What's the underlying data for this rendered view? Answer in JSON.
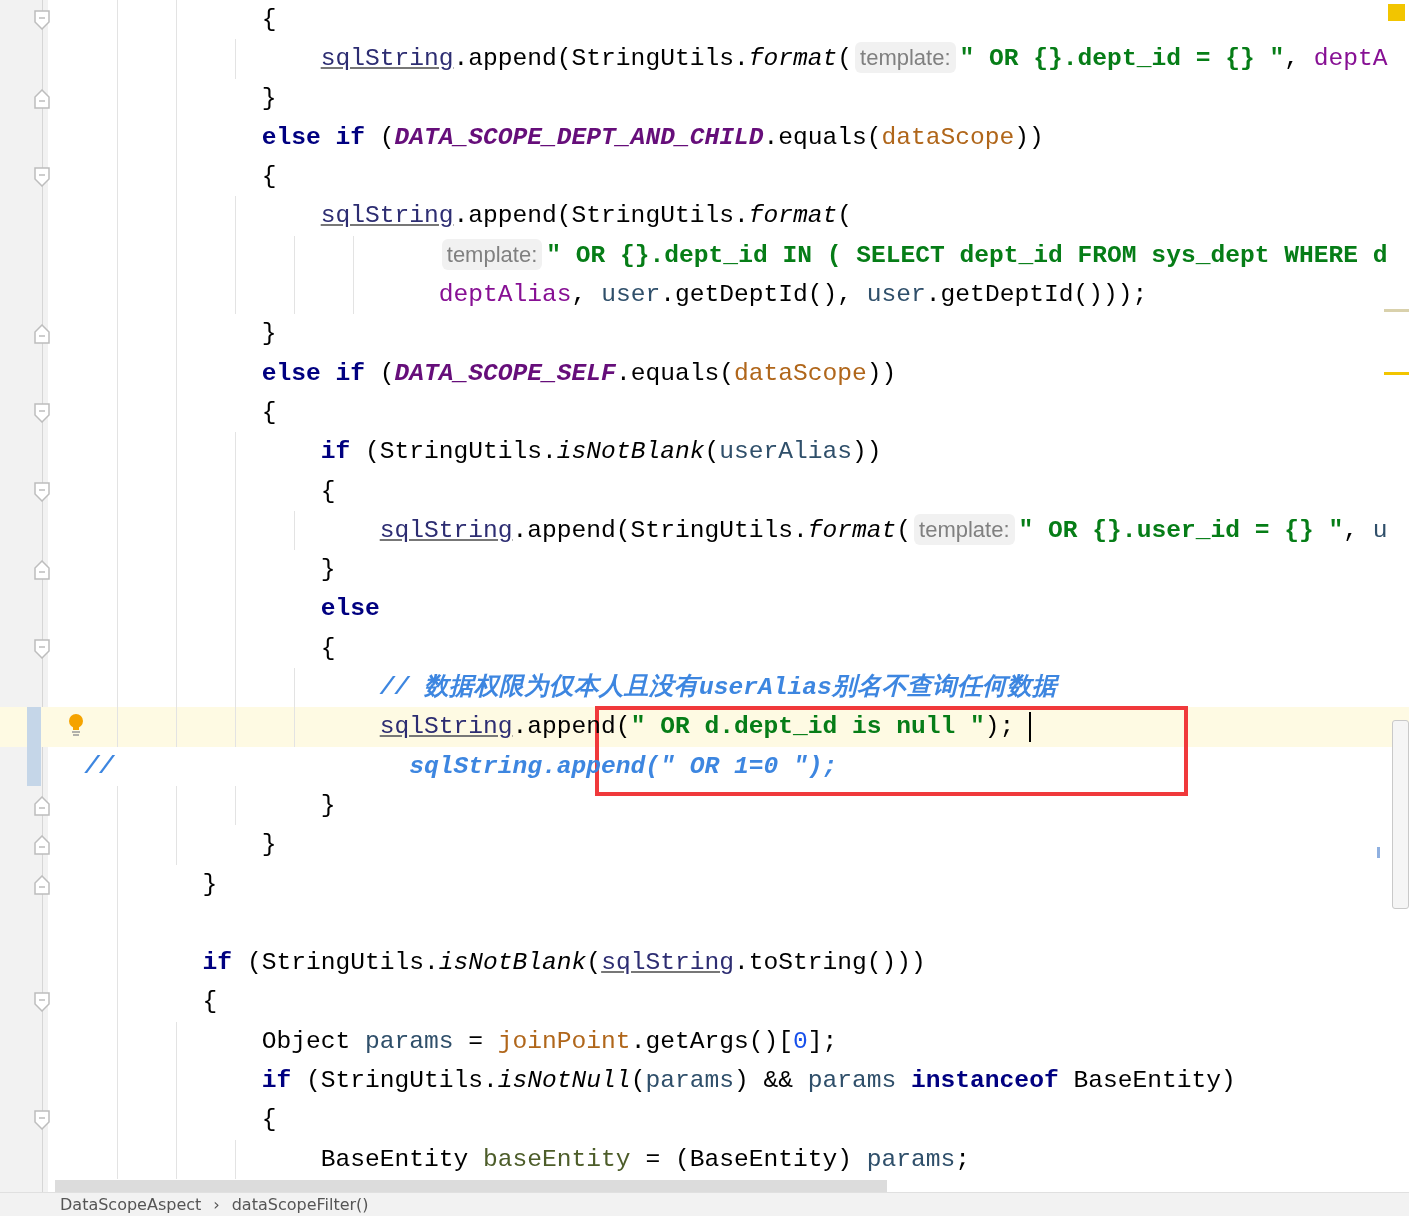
{
  "editor": {
    "lines": [
      {
        "kind": "fold-start",
        "current": false,
        "changed": false,
        "tokens": [
          {
            "kind": "plain",
            "text": "{"
          }
        ]
      },
      {
        "kind": "code",
        "current": false,
        "changed": false,
        "tokens": [
          {
            "kind": "var",
            "text": "sqlString"
          },
          {
            "kind": "plain",
            "text": ".append(StringUtils."
          },
          {
            "kind": "static",
            "text": "format"
          },
          {
            "kind": "plain",
            "text": "("
          },
          {
            "kind": "hint",
            "text": "template:"
          },
          {
            "kind": "string",
            "text": "\" OR {}.dept_id = {} \""
          },
          {
            "kind": "plain",
            "text": ", "
          },
          {
            "kind": "field",
            "text": "deptA"
          }
        ]
      },
      {
        "kind": "fold-end",
        "current": false,
        "changed": false,
        "tokens": [
          {
            "kind": "plain",
            "text": "}"
          }
        ]
      },
      {
        "kind": "code",
        "current": false,
        "changed": false,
        "tokens": [
          {
            "kind": "keyword",
            "text": "else if"
          },
          {
            "kind": "plain",
            "text": " ("
          },
          {
            "kind": "constant",
            "text": "DATA_SCOPE_DEPT_AND_CHILD"
          },
          {
            "kind": "plain",
            "text": ".equals("
          },
          {
            "kind": "param",
            "text": "dataScope"
          },
          {
            "kind": "plain",
            "text": "))"
          }
        ]
      },
      {
        "kind": "fold-start",
        "current": false,
        "changed": false,
        "tokens": [
          {
            "kind": "plain",
            "text": "{"
          }
        ]
      },
      {
        "kind": "code",
        "current": false,
        "changed": false,
        "tokens": [
          {
            "kind": "var",
            "text": "sqlString"
          },
          {
            "kind": "plain",
            "text": ".append(StringUtils."
          },
          {
            "kind": "static",
            "text": "format"
          },
          {
            "kind": "plain",
            "text": "("
          }
        ]
      },
      {
        "kind": "code",
        "current": false,
        "changed": false,
        "tokens": [
          {
            "kind": "hint",
            "text": "template:"
          },
          {
            "kind": "string",
            "text": "\" OR {}.dept_id IN ( SELECT dept_id FROM sys_dept WHERE d"
          }
        ]
      },
      {
        "kind": "code",
        "current": false,
        "changed": false,
        "tokens": [
          {
            "kind": "field",
            "text": "deptAlias"
          },
          {
            "kind": "plain",
            "text": ", "
          },
          {
            "kind": "local",
            "text": "user"
          },
          {
            "kind": "plain",
            "text": ".getDeptId(), "
          },
          {
            "kind": "local",
            "text": "user"
          },
          {
            "kind": "plain",
            "text": ".getDeptId()));"
          }
        ]
      },
      {
        "kind": "fold-end",
        "current": false,
        "changed": false,
        "tokens": [
          {
            "kind": "plain",
            "text": "}"
          }
        ]
      },
      {
        "kind": "code",
        "current": false,
        "changed": false,
        "tokens": [
          {
            "kind": "keyword",
            "text": "else if"
          },
          {
            "kind": "plain",
            "text": " ("
          },
          {
            "kind": "constant",
            "text": "DATA_SCOPE_SELF"
          },
          {
            "kind": "plain",
            "text": ".equals("
          },
          {
            "kind": "param",
            "text": "dataScope"
          },
          {
            "kind": "plain",
            "text": "))"
          }
        ]
      },
      {
        "kind": "fold-start",
        "current": false,
        "changed": false,
        "tokens": [
          {
            "kind": "plain",
            "text": "{"
          }
        ]
      },
      {
        "kind": "code",
        "current": false,
        "changed": false,
        "tokens": [
          {
            "kind": "keyword",
            "text": "if"
          },
          {
            "kind": "plain",
            "text": " (StringUtils."
          },
          {
            "kind": "static",
            "text": "isNotBlank"
          },
          {
            "kind": "plain",
            "text": "("
          },
          {
            "kind": "local",
            "text": "userAlias"
          },
          {
            "kind": "plain",
            "text": "))"
          }
        ]
      },
      {
        "kind": "fold-start",
        "current": false,
        "changed": false,
        "tokens": [
          {
            "kind": "plain",
            "text": "{"
          }
        ]
      },
      {
        "kind": "code",
        "current": false,
        "changed": false,
        "tokens": [
          {
            "kind": "var",
            "text": "sqlString"
          },
          {
            "kind": "plain",
            "text": ".append(StringUtils."
          },
          {
            "kind": "static",
            "text": "format"
          },
          {
            "kind": "plain",
            "text": "("
          },
          {
            "kind": "hint",
            "text": "template:"
          },
          {
            "kind": "string",
            "text": "\" OR {}.user_id = {} \""
          },
          {
            "kind": "plain",
            "text": ", "
          },
          {
            "kind": "local",
            "text": "u"
          }
        ]
      },
      {
        "kind": "fold-end",
        "current": false,
        "changed": false,
        "tokens": [
          {
            "kind": "plain",
            "text": "}"
          }
        ]
      },
      {
        "kind": "code",
        "current": false,
        "changed": false,
        "tokens": [
          {
            "kind": "keyword",
            "text": "else"
          }
        ]
      },
      {
        "kind": "fold-start",
        "current": false,
        "changed": false,
        "tokens": [
          {
            "kind": "plain",
            "text": "{"
          }
        ]
      },
      {
        "kind": "code",
        "current": false,
        "changed": false,
        "tokens": [
          {
            "kind": "comment",
            "text": "// 数据权限为仅本人且没有userAlias别名不查询任何数据"
          }
        ]
      },
      {
        "kind": "code",
        "current": true,
        "changed": true,
        "tokens": [
          {
            "kind": "var",
            "text": "sqlString"
          },
          {
            "kind": "plain",
            "text": ".append("
          },
          {
            "kind": "string",
            "text": "\" OR d.dept_id is null \""
          },
          {
            "kind": "plain",
            "text": ");"
          }
        ]
      },
      {
        "kind": "commented-out",
        "current": false,
        "changed": true,
        "tokens": [
          {
            "kind": "comment",
            "text": "//                    sqlString.append(\" OR 1=0 \");"
          }
        ]
      },
      {
        "kind": "fold-end",
        "current": false,
        "changed": false,
        "tokens": [
          {
            "kind": "plain",
            "text": "}"
          }
        ]
      },
      {
        "kind": "fold-end",
        "current": false,
        "changed": false,
        "tokens": [
          {
            "kind": "plain",
            "text": "}"
          }
        ]
      },
      {
        "kind": "fold-end",
        "current": false,
        "changed": false,
        "tokens": [
          {
            "kind": "plain",
            "text": "}"
          }
        ]
      },
      {
        "kind": "code",
        "current": false,
        "changed": false
      },
      {
        "kind": "code",
        "current": false,
        "changed": false,
        "tokens": [
          {
            "kind": "keyword",
            "text": "if"
          },
          {
            "kind": "plain",
            "text": " (StringUtils."
          },
          {
            "kind": "static",
            "text": "isNotBlank"
          },
          {
            "kind": "plain",
            "text": "("
          },
          {
            "kind": "var",
            "text": "sqlString"
          },
          {
            "kind": "plain",
            "text": ".toString()))"
          }
        ]
      },
      {
        "kind": "fold-start",
        "current": false,
        "changed": false,
        "tokens": [
          {
            "kind": "plain",
            "text": "{"
          }
        ]
      },
      {
        "kind": "code",
        "current": false,
        "changed": false,
        "tokens": [
          {
            "kind": "plain",
            "text": "Object "
          },
          {
            "kind": "local",
            "text": "params"
          },
          {
            "kind": "plain",
            "text": " = "
          },
          {
            "kind": "param",
            "text": "joinPoint"
          },
          {
            "kind": "plain",
            "text": ".getArgs()["
          },
          {
            "kind": "number",
            "text": "0"
          },
          {
            "kind": "plain",
            "text": "];"
          }
        ]
      },
      {
        "kind": "code",
        "current": false,
        "changed": false,
        "tokens": [
          {
            "kind": "keyword",
            "text": "if"
          },
          {
            "kind": "plain",
            "text": " (StringUtils."
          },
          {
            "kind": "static",
            "text": "isNotNull"
          },
          {
            "kind": "plain",
            "text": "("
          },
          {
            "kind": "local",
            "text": "params"
          },
          {
            "kind": "plain",
            "text": ") && "
          },
          {
            "kind": "local",
            "text": "params "
          },
          {
            "kind": "keyword",
            "text": "instanceof"
          },
          {
            "kind": "plain",
            "text": " BaseEntity)"
          }
        ]
      },
      {
        "kind": "fold-start",
        "current": false,
        "changed": false,
        "tokens": [
          {
            "kind": "plain",
            "text": "{"
          }
        ]
      },
      {
        "kind": "code",
        "current": false,
        "changed": false,
        "tokens": [
          {
            "kind": "plain",
            "text": "BaseEntity "
          },
          {
            "kind": "local2",
            "text": "baseEntity"
          },
          {
            "kind": "plain",
            "text": " = (BaseEntity) "
          },
          {
            "kind": "local",
            "text": "params"
          },
          {
            "kind": "plain",
            "text": ";"
          }
        ]
      }
    ]
  },
  "breadcrumb": {
    "items": [
      "DataScopeAspect",
      "dataScopeFilter()"
    ],
    "separator": "›"
  }
}
